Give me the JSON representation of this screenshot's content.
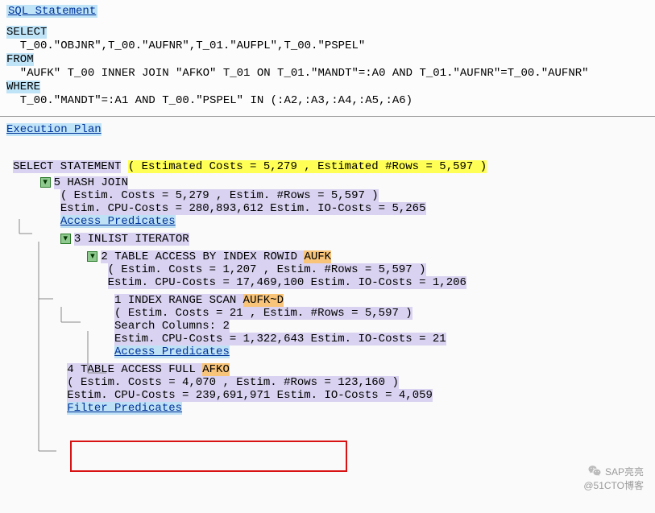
{
  "headers": {
    "sql": "SQL Statement",
    "plan": "Execution Plan"
  },
  "sql": {
    "l1": "SELECT",
    "l2": "  T_00.\"OBJNR\",T_00.\"AUFNR\",T_01.\"AUFPL\",T_00.\"PSPEL\"",
    "l3": "FROM",
    "l4": "  \"AUFK\" T_00 INNER JOIN \"AFKO\" T_01 ON T_01.\"MANDT\"=:A0 AND T_01.\"AUFNR\"=T_00.\"AUFNR\"",
    "l5": "WHERE",
    "l6": "  T_00.\"MANDT\"=:A1 AND T_00.\"PSPEL\" IN (:A2,:A3,:A4,:A5,:A6)"
  },
  "tree": {
    "root": {
      "label": "SELECT STATEMENT",
      "est": "( Estimated Costs = 5,279 , Estimated #Rows = 5,597 )"
    },
    "n5": {
      "title": "5 HASH JOIN",
      "l1": "( Estim. Costs = 5,279 , Estim. #Rows = 5,597 )",
      "l2": "Estim. CPU-Costs = 280,893,612 Estim. IO-Costs = 5,265",
      "link": "Access Predicates"
    },
    "n3": {
      "title": "3 INLIST ITERATOR"
    },
    "n2": {
      "title_a": "2 TABLE ACCESS BY INDEX ROWID ",
      "tbl": "AUFK",
      "l1": "( Estim. Costs = 1,207 , Estim. #Rows = 5,597 )",
      "l2": "Estim. CPU-Costs = 17,469,100 Estim. IO-Costs = 1,206"
    },
    "n1": {
      "title_a": "1 INDEX RANGE SCAN ",
      "idx": "AUFK~D",
      "l1": "( Estim. Costs = 21 , Estim. #Rows = 5,597 )",
      "l2": "Search Columns: 2",
      "l3": "Estim. CPU-Costs = 1,322,643 Estim. IO-Costs = 21",
      "link": "Access Predicates"
    },
    "n4": {
      "title_a": "4 TABLE ACCESS FULL ",
      "tbl": "AFKO",
      "l1": "( Estim. Costs = 4,070 , Estim. #Rows = 123,160 )",
      "l2": "Estim. CPU-Costs = 239,691,971 Estim. IO-Costs = 4,059",
      "link": "Filter Predicates"
    }
  },
  "watermark": {
    "line1": "SAP亮亮",
    "line2": "@51CTO博客"
  }
}
